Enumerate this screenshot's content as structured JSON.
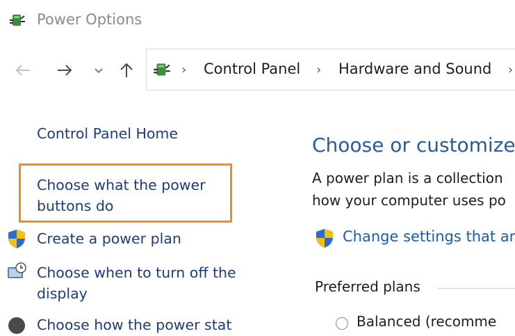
{
  "window": {
    "title": "Power Options"
  },
  "address_bar": {
    "breadcrumbs": [
      "Control Panel",
      "Hardware and Sound"
    ]
  },
  "left_pane": {
    "home_link": "Control Panel Home",
    "tasks": [
      {
        "label_line1": "Choose what the power",
        "label_line2": "buttons do"
      },
      {
        "label": "Create a power plan"
      },
      {
        "label_line1": "Choose when to turn off the",
        "label_line2": "display"
      },
      {
        "label": "Choose how the power stat"
      }
    ]
  },
  "main": {
    "heading": "Choose or customize",
    "description_line1": "A power plan is a collection",
    "description_line2": "how your computer uses po",
    "change_settings_link": "Change settings that ar",
    "preferred_plans_label": "Preferred plans",
    "plans": [
      {
        "name": "Balanced (recomme"
      }
    ]
  },
  "colors": {
    "highlight": "#f08c1e",
    "link": "#1e3c78",
    "heading": "#2a5a9a"
  },
  "icons": [
    "power-options-icon",
    "back-arrow-icon",
    "forward-arrow-icon",
    "chevron-down-icon",
    "up-arrow-icon",
    "uac-shield-icon",
    "display-clock-icon"
  ]
}
